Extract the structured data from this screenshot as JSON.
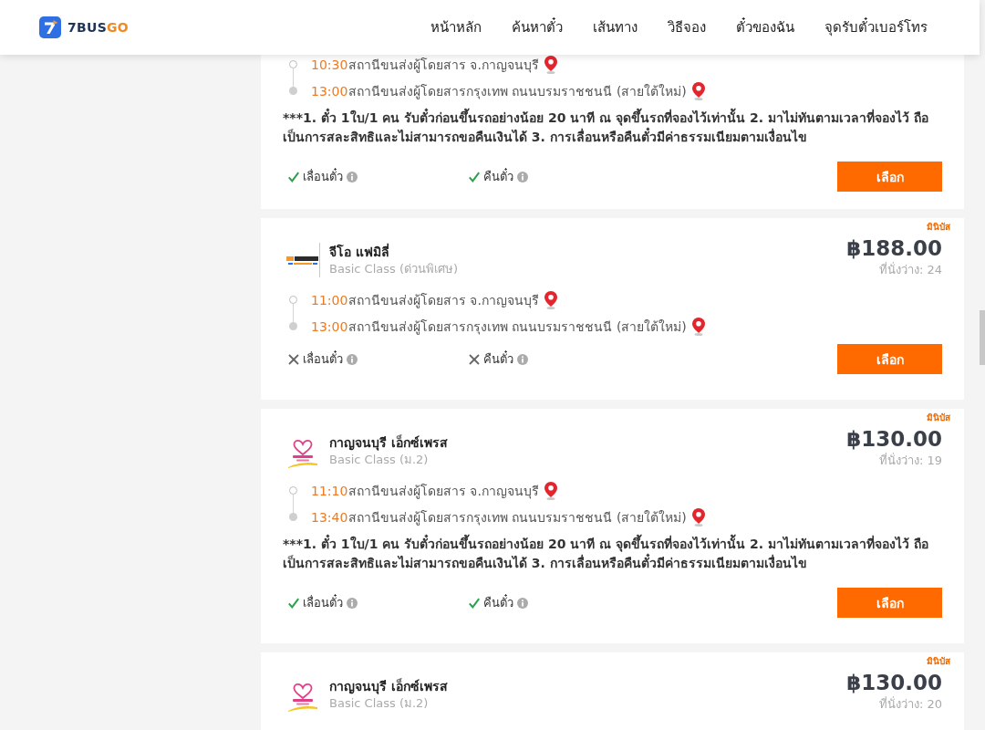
{
  "header": {
    "logo": {
      "name": "7BUS",
      "accent": "GO"
    },
    "nav": [
      {
        "label": "หน้าหลัก"
      },
      {
        "label": "ค้นหาตั๋ว"
      },
      {
        "label": "เส้นทาง"
      },
      {
        "label": "วิธีจอง"
      },
      {
        "label": "ตั๋วของฉัน"
      },
      {
        "label": "จุดรับตั๋วเบอร์โทร"
      }
    ]
  },
  "trips": [
    {
      "stops": [
        {
          "kind": "departure",
          "time": "10:30",
          "station": "สถานีขนส่งผู้โดยสาร จ.กาญจนบุรี"
        },
        {
          "kind": "arrival",
          "time": "13:00",
          "station": "สถานีขนส่งผู้โดยสารกรุงเทพ ถนนบรมราชชนนี (สายใต้ใหม่)"
        }
      ],
      "note": "***1. ตั๋ว 1ใบ/1 คน รับตั๋วก่อนขึ้นรถอย่างน้อย 20 นาที ณ จุดขึ้นรถที่จองไว้เท่านั้น 2. มาไม่ทันตามเวลาที่จองไว้ ถือเป็นการสละสิทธิและไม่สามารถขอคืนเงินได้ 3. การเลื่อนหรือคืนตั๋วมีค่าธรรมเนียมตามเงื่อนไข",
      "features": [
        {
          "label": "เลื่อนตั๋ว",
          "available": true
        },
        {
          "label": "คืนตั๋ว",
          "available": true
        }
      ],
      "button": "เลือก"
    },
    {
      "badge": "มินิบัส",
      "operator": {
        "kind": "banner",
        "name": "จีโอ แฟมิลี่",
        "class": "Basic Class (ด่วนพิเศษ)"
      },
      "price": "฿188.00",
      "seats": "ที่นั่งว่าง: 24",
      "stops": [
        {
          "kind": "departure",
          "time": "11:00",
          "station": "สถานีขนส่งผู้โดยสาร จ.กาญจนบุรี"
        },
        {
          "kind": "arrival",
          "time": "13:00",
          "station": "สถานีขนส่งผู้โดยสารกรุงเทพ ถนนบรมราชชนนี (สายใต้ใหม่)"
        }
      ],
      "features": [
        {
          "label": "เลื่อนตั๋ว",
          "available": false
        },
        {
          "label": "คืนตั๋ว",
          "available": false
        }
      ],
      "button": "เลือก"
    },
    {
      "badge": "มินิบัส",
      "operator": {
        "kind": "heart",
        "name": "กาญจนบุรี เอ็กซ์เพรส",
        "class": "Basic Class (ม.2)"
      },
      "price": "฿130.00",
      "seats": "ที่นั่งว่าง: 19",
      "stops": [
        {
          "kind": "departure",
          "time": "11:10",
          "station": "สถานีขนส่งผู้โดยสาร จ.กาญจนบุรี"
        },
        {
          "kind": "arrival",
          "time": "13:40",
          "station": "สถานีขนส่งผู้โดยสารกรุงเทพ ถนนบรมราชชนนี (สายใต้ใหม่)"
        }
      ],
      "note": "***1. ตั๋ว 1ใบ/1 คน รับตั๋วก่อนขึ้นรถอย่างน้อย 20 นาที ณ จุดขึ้นรถที่จองไว้เท่านั้น 2. มาไม่ทันตามเวลาที่จองไว้ ถือเป็นการสละสิทธิและไม่สามารถขอคืนเงินได้ 3. การเลื่อนหรือคืนตั๋วมีค่าธรรมเนียมตามเงื่อนไข",
      "features": [
        {
          "label": "เลื่อนตั๋ว",
          "available": true
        },
        {
          "label": "คืนตั๋ว",
          "available": true
        }
      ],
      "button": "เลือก"
    },
    {
      "badge": "มินิบัส",
      "operator": {
        "kind": "heart",
        "name": "กาญจนบุรี เอ็กซ์เพรส",
        "class": "Basic Class (ม.2)"
      },
      "price": "฿130.00",
      "seats": "ที่นั่งว่าง: 20"
    }
  ]
}
